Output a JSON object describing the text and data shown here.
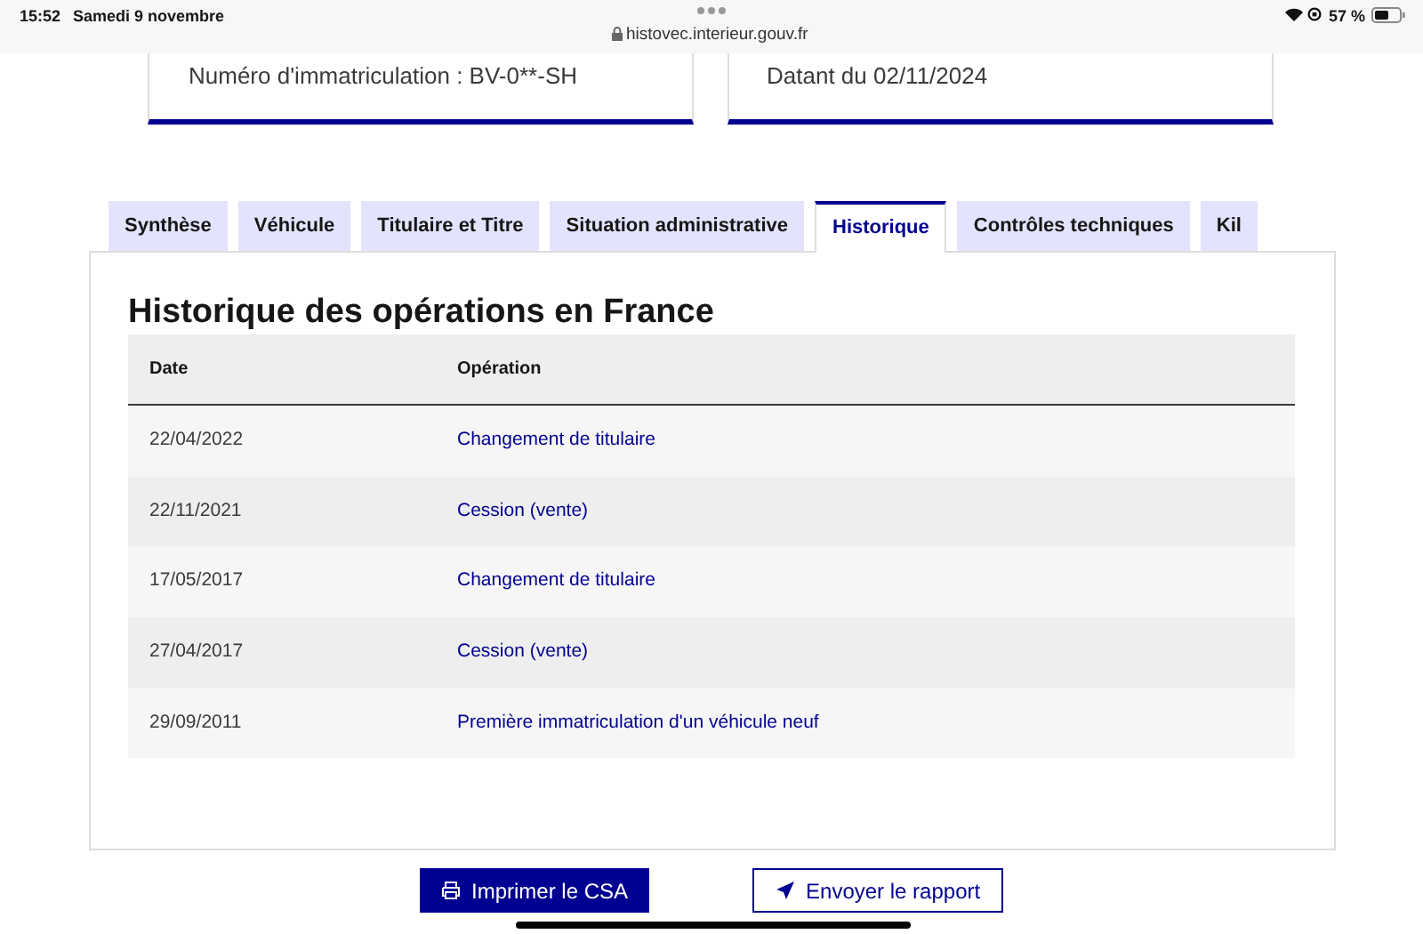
{
  "status_bar": {
    "time": "15:52",
    "date": "Samedi 9 novembre",
    "url": "histovec.interieur.gouv.fr",
    "battery": "57 %"
  },
  "cards": [
    {
      "text": "Numéro d'immatriculation : BV-0**-SH"
    },
    {
      "text": "Datant du 02/11/2024"
    }
  ],
  "tabs": [
    {
      "label": "Synthèse",
      "selected": false
    },
    {
      "label": "Véhicule",
      "selected": false
    },
    {
      "label": "Titulaire et Titre",
      "selected": false
    },
    {
      "label": "Situation administrative",
      "selected": false
    },
    {
      "label": "Historique",
      "selected": true
    },
    {
      "label": "Contrôles techniques",
      "selected": false
    },
    {
      "label": "Kil",
      "selected": false
    }
  ],
  "section_title": "Historique des opérations en France",
  "table": {
    "columns": [
      "Date",
      "Opération"
    ],
    "rows": [
      [
        "22/04/2022",
        "Changement de titulaire"
      ],
      [
        "22/11/2021",
        "Cession (vente)"
      ],
      [
        "17/05/2017",
        "Changement de titulaire"
      ],
      [
        "27/04/2017",
        "Cession (vente)"
      ],
      [
        "29/09/2011",
        "Première immatriculation d'un véhicule neuf"
      ]
    ]
  },
  "buttons": [
    {
      "label": "Imprimer le CSA",
      "kind": "primary"
    },
    {
      "label": "Envoyer le rapport",
      "kind": "secondary"
    }
  ]
}
